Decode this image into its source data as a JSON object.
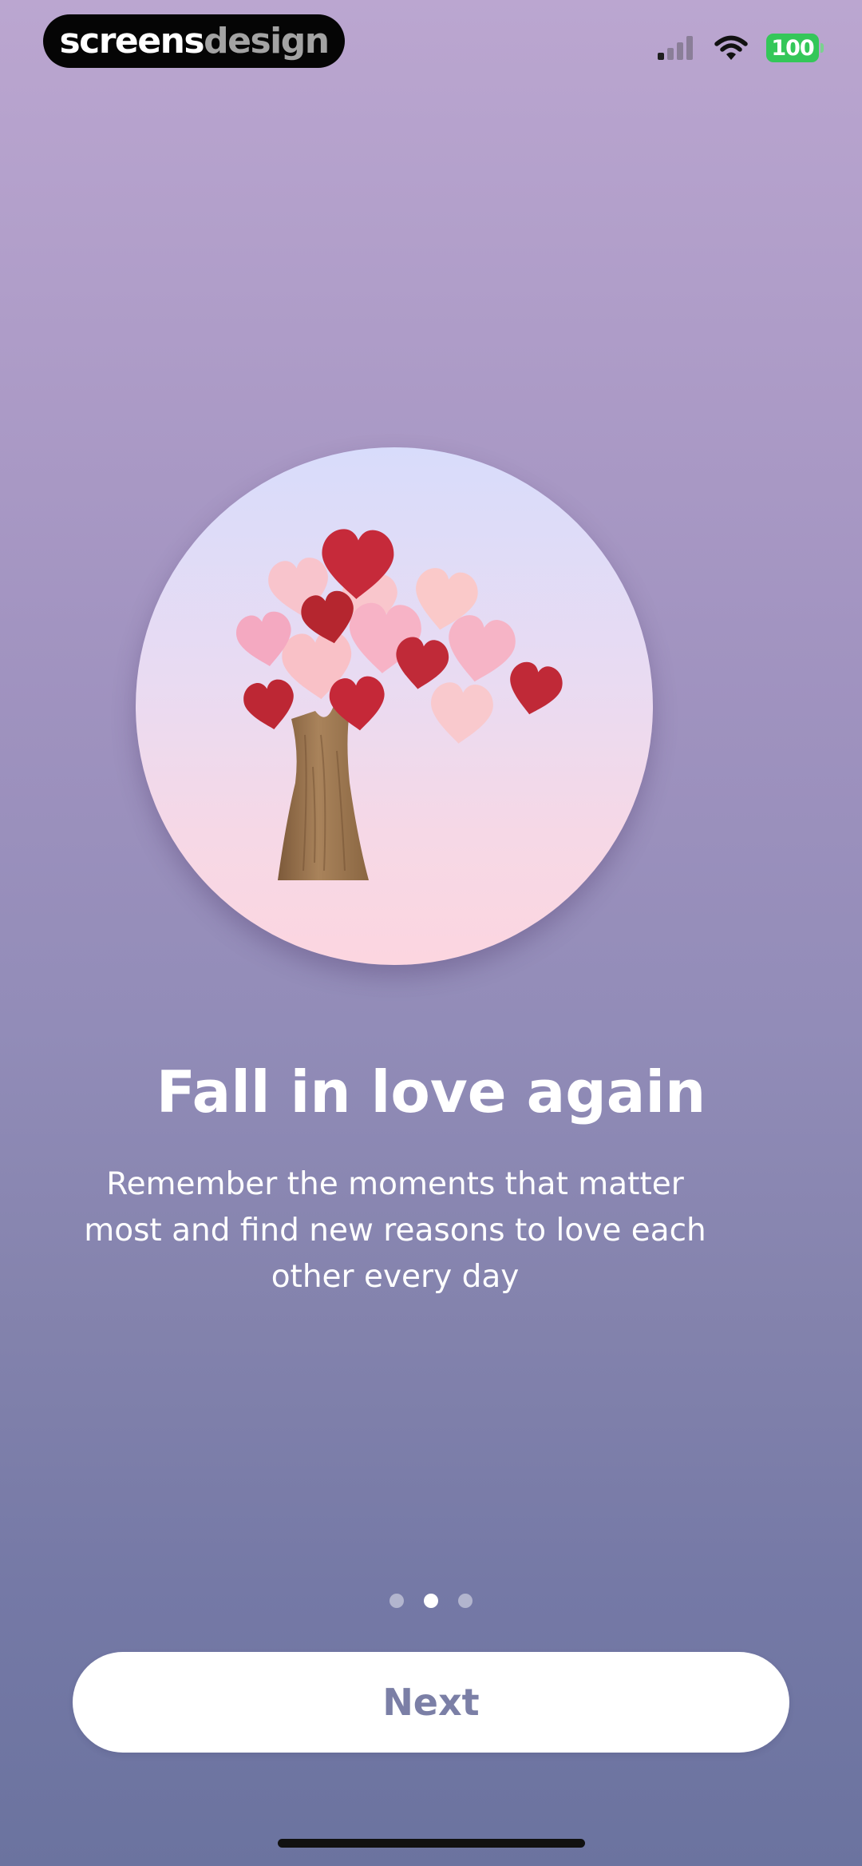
{
  "status_bar": {
    "brand_primary": "screens",
    "brand_secondary": "design",
    "battery_level": "100",
    "icons": [
      "cellular-signal-icon",
      "wifi-icon",
      "battery-icon"
    ],
    "battery_color": "#34c759"
  },
  "onboarding": {
    "hero_image": "heart-tree-illustration",
    "title": "Fall in love again",
    "description_lines": [
      "Remember the moments that matter",
      "most and find new reasons to love each",
      "other every day"
    ],
    "pager": {
      "total": 3,
      "active_index": 1
    },
    "next_button_label": "Next"
  },
  "colors": {
    "background_top": "#bba6d0",
    "background_bottom": "#6b739f",
    "button_text": "#7b7fa6",
    "heart_red": "#c52838",
    "heart_pink": "#f6a9bf",
    "trunk": "#9c7650"
  }
}
